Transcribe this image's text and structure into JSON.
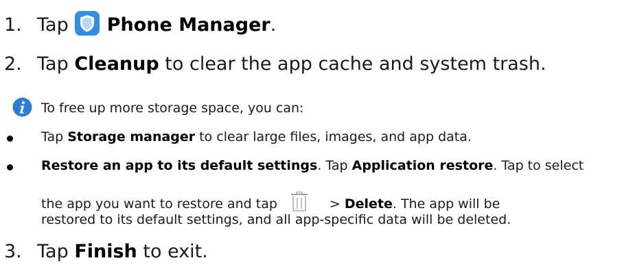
{
  "steps": [
    {
      "num": "1.",
      "pre": "Tap",
      "bold": "Phone Manager",
      "post": ".",
      "icon": "phone-manager-shield-icon"
    },
    {
      "num": "2.",
      "pre": "Tap",
      "bold": "Cleanup",
      "post": "to clear the app cache and system trash."
    },
    {
      "num": "3.",
      "pre": "Tap",
      "bold": "Finish",
      "post": "to exit."
    }
  ],
  "note": {
    "icon": "info-icon",
    "intro": "To free up more storage space, you can:",
    "bullets": [
      {
        "pre": "Tap",
        "bold": "Storage manager",
        "post": "to clear large files, images, and app data."
      },
      {
        "bold1": "Restore an app to its default settings",
        "mid1": ". Tap",
        "bold2": "Application restore",
        "mid2": ". Tap to select",
        "line2_pre": "the app you want to restore and tap",
        "line2_icon": "trash-icon",
        "line2_gt": ">",
        "line2_bold": "Delete",
        "line2_post": ". The app will be",
        "line3": "restored to its default settings, and all app-specific data will be deleted."
      }
    ]
  },
  "colors": {
    "shield": "#2f8fe8",
    "info": "#2a7fd4",
    "text": "#1a1a1a"
  }
}
